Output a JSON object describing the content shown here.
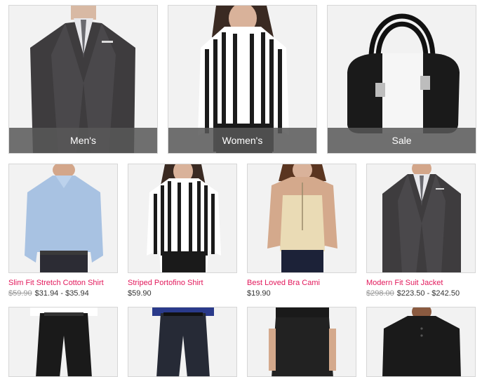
{
  "categories": [
    {
      "label": "Men's"
    },
    {
      "label": "Women's"
    },
    {
      "label": "Sale"
    }
  ],
  "products": [
    {
      "name": "Slim Fit Stretch Cotton Shirt",
      "old_price": "$59.90",
      "price": "$31.94 - $35.94"
    },
    {
      "name": "Striped Portofino Shirt",
      "old_price": "",
      "price": "$59.90"
    },
    {
      "name": "Best Loved Bra Cami",
      "old_price": "",
      "price": "$19.90"
    },
    {
      "name": "Modern Fit Suit Jacket",
      "old_price": "$298.00",
      "price": "$223.50 - $242.50"
    }
  ],
  "colors": {
    "accent": "#e2185b",
    "overlay": "#585858"
  }
}
